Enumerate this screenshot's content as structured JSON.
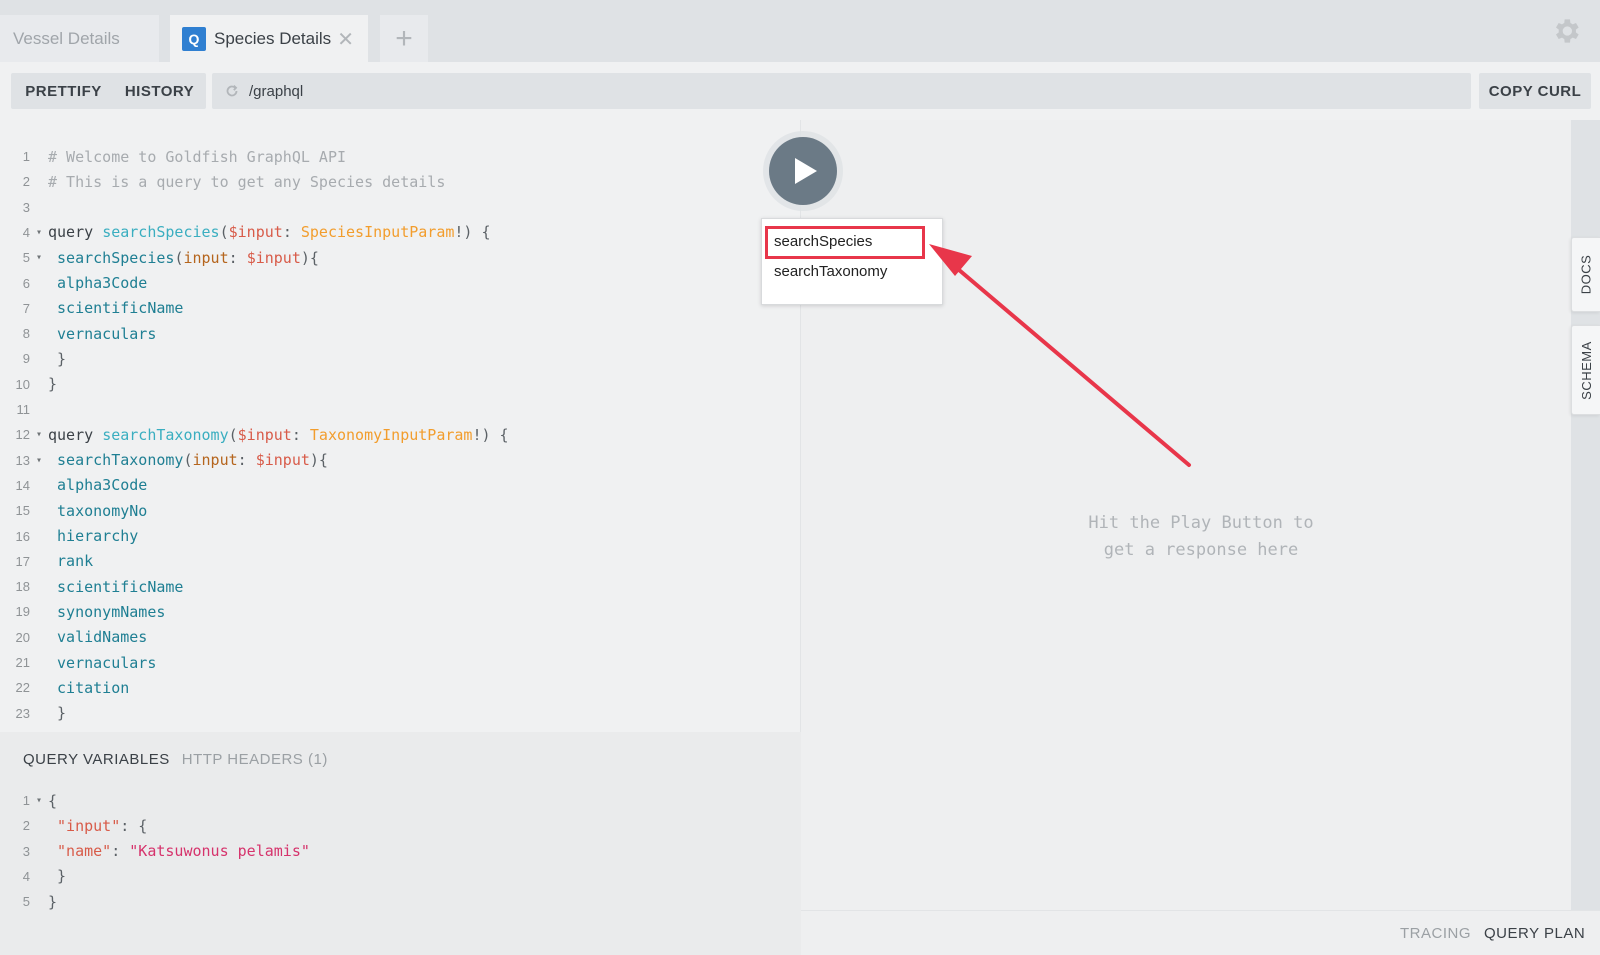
{
  "tabs": [
    {
      "label": "Vessel Details",
      "active": false
    },
    {
      "label": "Species Details",
      "active": true,
      "badge": "Q"
    }
  ],
  "toolbar": {
    "prettify": "PRETTIFY",
    "history": "HISTORY",
    "url": "/graphql",
    "copy_curl": "COPY CURL"
  },
  "editor": {
    "lines": [
      {
        "n": "1",
        "fold": "",
        "tokens": [
          {
            "t": "# Welcome to Goldfish GraphQL API",
            "c": "comment"
          }
        ]
      },
      {
        "n": "2",
        "fold": "",
        "tokens": [
          {
            "t": "# This is a query to get any Species details",
            "c": "comment"
          }
        ]
      },
      {
        "n": "3",
        "fold": "",
        "tokens": []
      },
      {
        "n": "4",
        "fold": "▾",
        "tokens": [
          {
            "t": "query ",
            "c": "kw"
          },
          {
            "t": "searchSpecies",
            "c": "def"
          },
          {
            "t": "(",
            "c": "punc"
          },
          {
            "t": "$input",
            "c": "var"
          },
          {
            "t": ": ",
            "c": "punc"
          },
          {
            "t": "SpeciesInputParam",
            "c": "type"
          },
          {
            "t": "!) {",
            "c": "punc"
          }
        ]
      },
      {
        "n": "5",
        "fold": "▾",
        "tokens": [
          {
            "t": " searchSpecies",
            "c": "field"
          },
          {
            "t": "(",
            "c": "punc"
          },
          {
            "t": "input",
            "c": "arg"
          },
          {
            "t": ": ",
            "c": "punc"
          },
          {
            "t": "$input",
            "c": "var"
          },
          {
            "t": "){",
            "c": "punc"
          }
        ]
      },
      {
        "n": "6",
        "fold": "",
        "tokens": [
          {
            "t": " alpha3Code",
            "c": "field"
          }
        ]
      },
      {
        "n": "7",
        "fold": "",
        "tokens": [
          {
            "t": " scientificName",
            "c": "field"
          }
        ]
      },
      {
        "n": "8",
        "fold": "",
        "tokens": [
          {
            "t": " vernaculars",
            "c": "field"
          }
        ]
      },
      {
        "n": "9",
        "fold": "",
        "tokens": [
          {
            "t": " }",
            "c": "punc"
          }
        ]
      },
      {
        "n": "10",
        "fold": "",
        "tokens": [
          {
            "t": "}",
            "c": "punc"
          }
        ]
      },
      {
        "n": "11",
        "fold": "",
        "tokens": []
      },
      {
        "n": "12",
        "fold": "▾",
        "tokens": [
          {
            "t": "query ",
            "c": "kw"
          },
          {
            "t": "searchTaxonomy",
            "c": "def"
          },
          {
            "t": "(",
            "c": "punc"
          },
          {
            "t": "$input",
            "c": "var"
          },
          {
            "t": ": ",
            "c": "punc"
          },
          {
            "t": "TaxonomyInputParam",
            "c": "type"
          },
          {
            "t": "!) {",
            "c": "punc"
          }
        ]
      },
      {
        "n": "13",
        "fold": "▾",
        "tokens": [
          {
            "t": " searchTaxonomy",
            "c": "field"
          },
          {
            "t": "(",
            "c": "punc"
          },
          {
            "t": "input",
            "c": "arg"
          },
          {
            "t": ": ",
            "c": "punc"
          },
          {
            "t": "$input",
            "c": "var"
          },
          {
            "t": "){",
            "c": "punc"
          }
        ]
      },
      {
        "n": "14",
        "fold": "",
        "tokens": [
          {
            "t": " alpha3Code",
            "c": "field"
          }
        ]
      },
      {
        "n": "15",
        "fold": "",
        "tokens": [
          {
            "t": " taxonomyNo",
            "c": "field"
          }
        ]
      },
      {
        "n": "16",
        "fold": "",
        "tokens": [
          {
            "t": " hierarchy",
            "c": "field"
          }
        ]
      },
      {
        "n": "17",
        "fold": "",
        "tokens": [
          {
            "t": " rank",
            "c": "field"
          }
        ]
      },
      {
        "n": "18",
        "fold": "",
        "tokens": [
          {
            "t": " scientificName",
            "c": "field"
          }
        ]
      },
      {
        "n": "19",
        "fold": "",
        "tokens": [
          {
            "t": " synonymNames",
            "c": "field"
          }
        ]
      },
      {
        "n": "20",
        "fold": "",
        "tokens": [
          {
            "t": " validNames",
            "c": "field"
          }
        ]
      },
      {
        "n": "21",
        "fold": "",
        "tokens": [
          {
            "t": " vernaculars",
            "c": "field"
          }
        ]
      },
      {
        "n": "22",
        "fold": "",
        "tokens": [
          {
            "t": " citation",
            "c": "field"
          }
        ]
      },
      {
        "n": "23",
        "fold": "",
        "tokens": [
          {
            "t": " }",
            "c": "punc"
          }
        ]
      }
    ]
  },
  "operation_menu": {
    "items": [
      "searchSpecies",
      "searchTaxonomy"
    ],
    "highlighted": "searchSpecies"
  },
  "variables": {
    "tab_query_variables": "QUERY VARIABLES",
    "tab_http_headers": "HTTP HEADERS (1)",
    "lines": [
      {
        "n": "1",
        "fold": "▾",
        "tokens": [
          {
            "t": "{",
            "c": "punc"
          }
        ]
      },
      {
        "n": "2",
        "fold": "",
        "tokens": [
          {
            "t": " \"input\"",
            "c": "key"
          },
          {
            "t": ": {",
            "c": "punc"
          }
        ]
      },
      {
        "n": "3",
        "fold": "",
        "tokens": [
          {
            "t": " \"name\"",
            "c": "key"
          },
          {
            "t": ": ",
            "c": "punc"
          },
          {
            "t": "\"Katsuwonus pelamis\"",
            "c": "str"
          }
        ]
      },
      {
        "n": "4",
        "fold": "",
        "tokens": [
          {
            "t": " }",
            "c": "punc"
          }
        ]
      },
      {
        "n": "5",
        "fold": "",
        "tokens": [
          {
            "t": "}",
            "c": "punc"
          }
        ]
      }
    ]
  },
  "result": {
    "placeholder_line1": "Hit the Play Button to",
    "placeholder_line2": "get a response here"
  },
  "footer": {
    "tracing": "TRACING",
    "query_plan": "QUERY PLAN"
  },
  "side_tabs": {
    "docs": "DOCS",
    "schema": "SCHEMA"
  },
  "colors": {
    "annotation": "#e8364a",
    "run_button": "#6b7a86",
    "tab_badge": "#2f7fd1"
  }
}
